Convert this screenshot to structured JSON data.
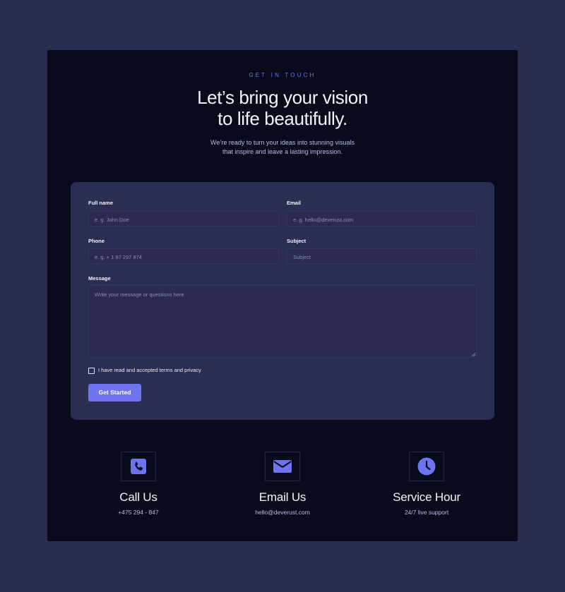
{
  "header": {
    "eyebrow": "GET IN TOUCH",
    "title_line1": "Let’s bring your vision",
    "title_line2": "to life beautifully.",
    "subtitle_line1": "We’re ready to turn your ideas into stunning visuals",
    "subtitle_line2": "that inspire and leave a lasting impression."
  },
  "form": {
    "full_name": {
      "label": "Full name",
      "placeholder": "e. g. John Doe"
    },
    "email": {
      "label": "Email",
      "placeholder": "e. g. hello@deverust.com"
    },
    "phone": {
      "label": "Phone",
      "placeholder": "e. g. + 1 97 297 874"
    },
    "subject": {
      "label": "Subject",
      "placeholder": "Subject"
    },
    "message": {
      "label": "Message",
      "placeholder": "Write your message or questions here"
    },
    "terms_label": "I have read and accepted terms and privacy",
    "submit_label": "Get Started"
  },
  "contacts": [
    {
      "icon": "phone-icon",
      "title": "Call Us",
      "text": "+475 294 - 847"
    },
    {
      "icon": "mail-icon",
      "title": "Email Us",
      "text": "hello@deverust.com"
    },
    {
      "icon": "clock-icon",
      "title": "Service Hour",
      "text": "24/7 live support"
    }
  ],
  "colors": {
    "page_background": "#2b2d4f",
    "panel_background": "#080b1b",
    "card_background": "#2c2d53",
    "accent": "#6e74ef",
    "eyebrow": "#6f74e8"
  }
}
